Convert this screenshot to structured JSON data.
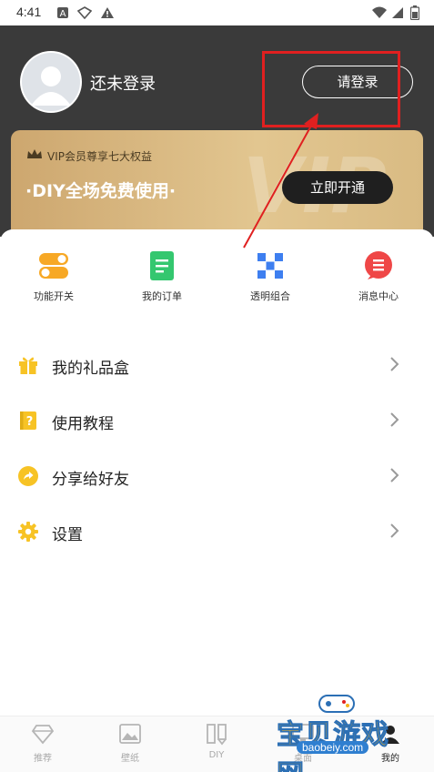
{
  "status_bar": {
    "time": "4:41",
    "left_icons": [
      "a-notification-icon",
      "shield-icon",
      "warning-icon"
    ],
    "right_icons": [
      "wifi-icon",
      "signal-icon",
      "battery-icon"
    ]
  },
  "profile": {
    "username": "还未登录",
    "login_label": "请登录"
  },
  "vip": {
    "subtitle": "VIP会员尊享七大权益",
    "title": "·DIY全场免费使用·",
    "watermark": "VIP",
    "button_label": "立即开通"
  },
  "quick_actions": [
    {
      "label": "功能开关",
      "icon": "toggle-icon"
    },
    {
      "label": "我的订单",
      "icon": "order-icon"
    },
    {
      "label": "透明组合",
      "icon": "grid-combo-icon"
    },
    {
      "label": "消息中心",
      "icon": "message-icon"
    }
  ],
  "menu": [
    {
      "label": "我的礼品盒",
      "icon": "gift-icon"
    },
    {
      "label": "使用教程",
      "icon": "tutorial-icon"
    },
    {
      "label": "分享给好友",
      "icon": "share-icon"
    },
    {
      "label": "设置",
      "icon": "gear-icon"
    }
  ],
  "bottom_nav": [
    {
      "label": "推荐",
      "icon": "diamond-icon",
      "active": false
    },
    {
      "label": "壁纸",
      "icon": "picture-icon",
      "active": false
    },
    {
      "label": "DIY",
      "icon": "diy-icon",
      "active": false
    },
    {
      "label": "桌面",
      "icon": "desktop-icon",
      "active": false
    },
    {
      "label": "我的",
      "icon": "profile-icon",
      "active": true
    }
  ],
  "watermark": {
    "text": "宝贝游戏网",
    "url": "baobeiy.com"
  },
  "colors": {
    "header_bg": "#3a3a3a",
    "vip_gold": "#d9bb83",
    "annotation_red": "#e02020",
    "accent_yellow": "#f7c325"
  }
}
